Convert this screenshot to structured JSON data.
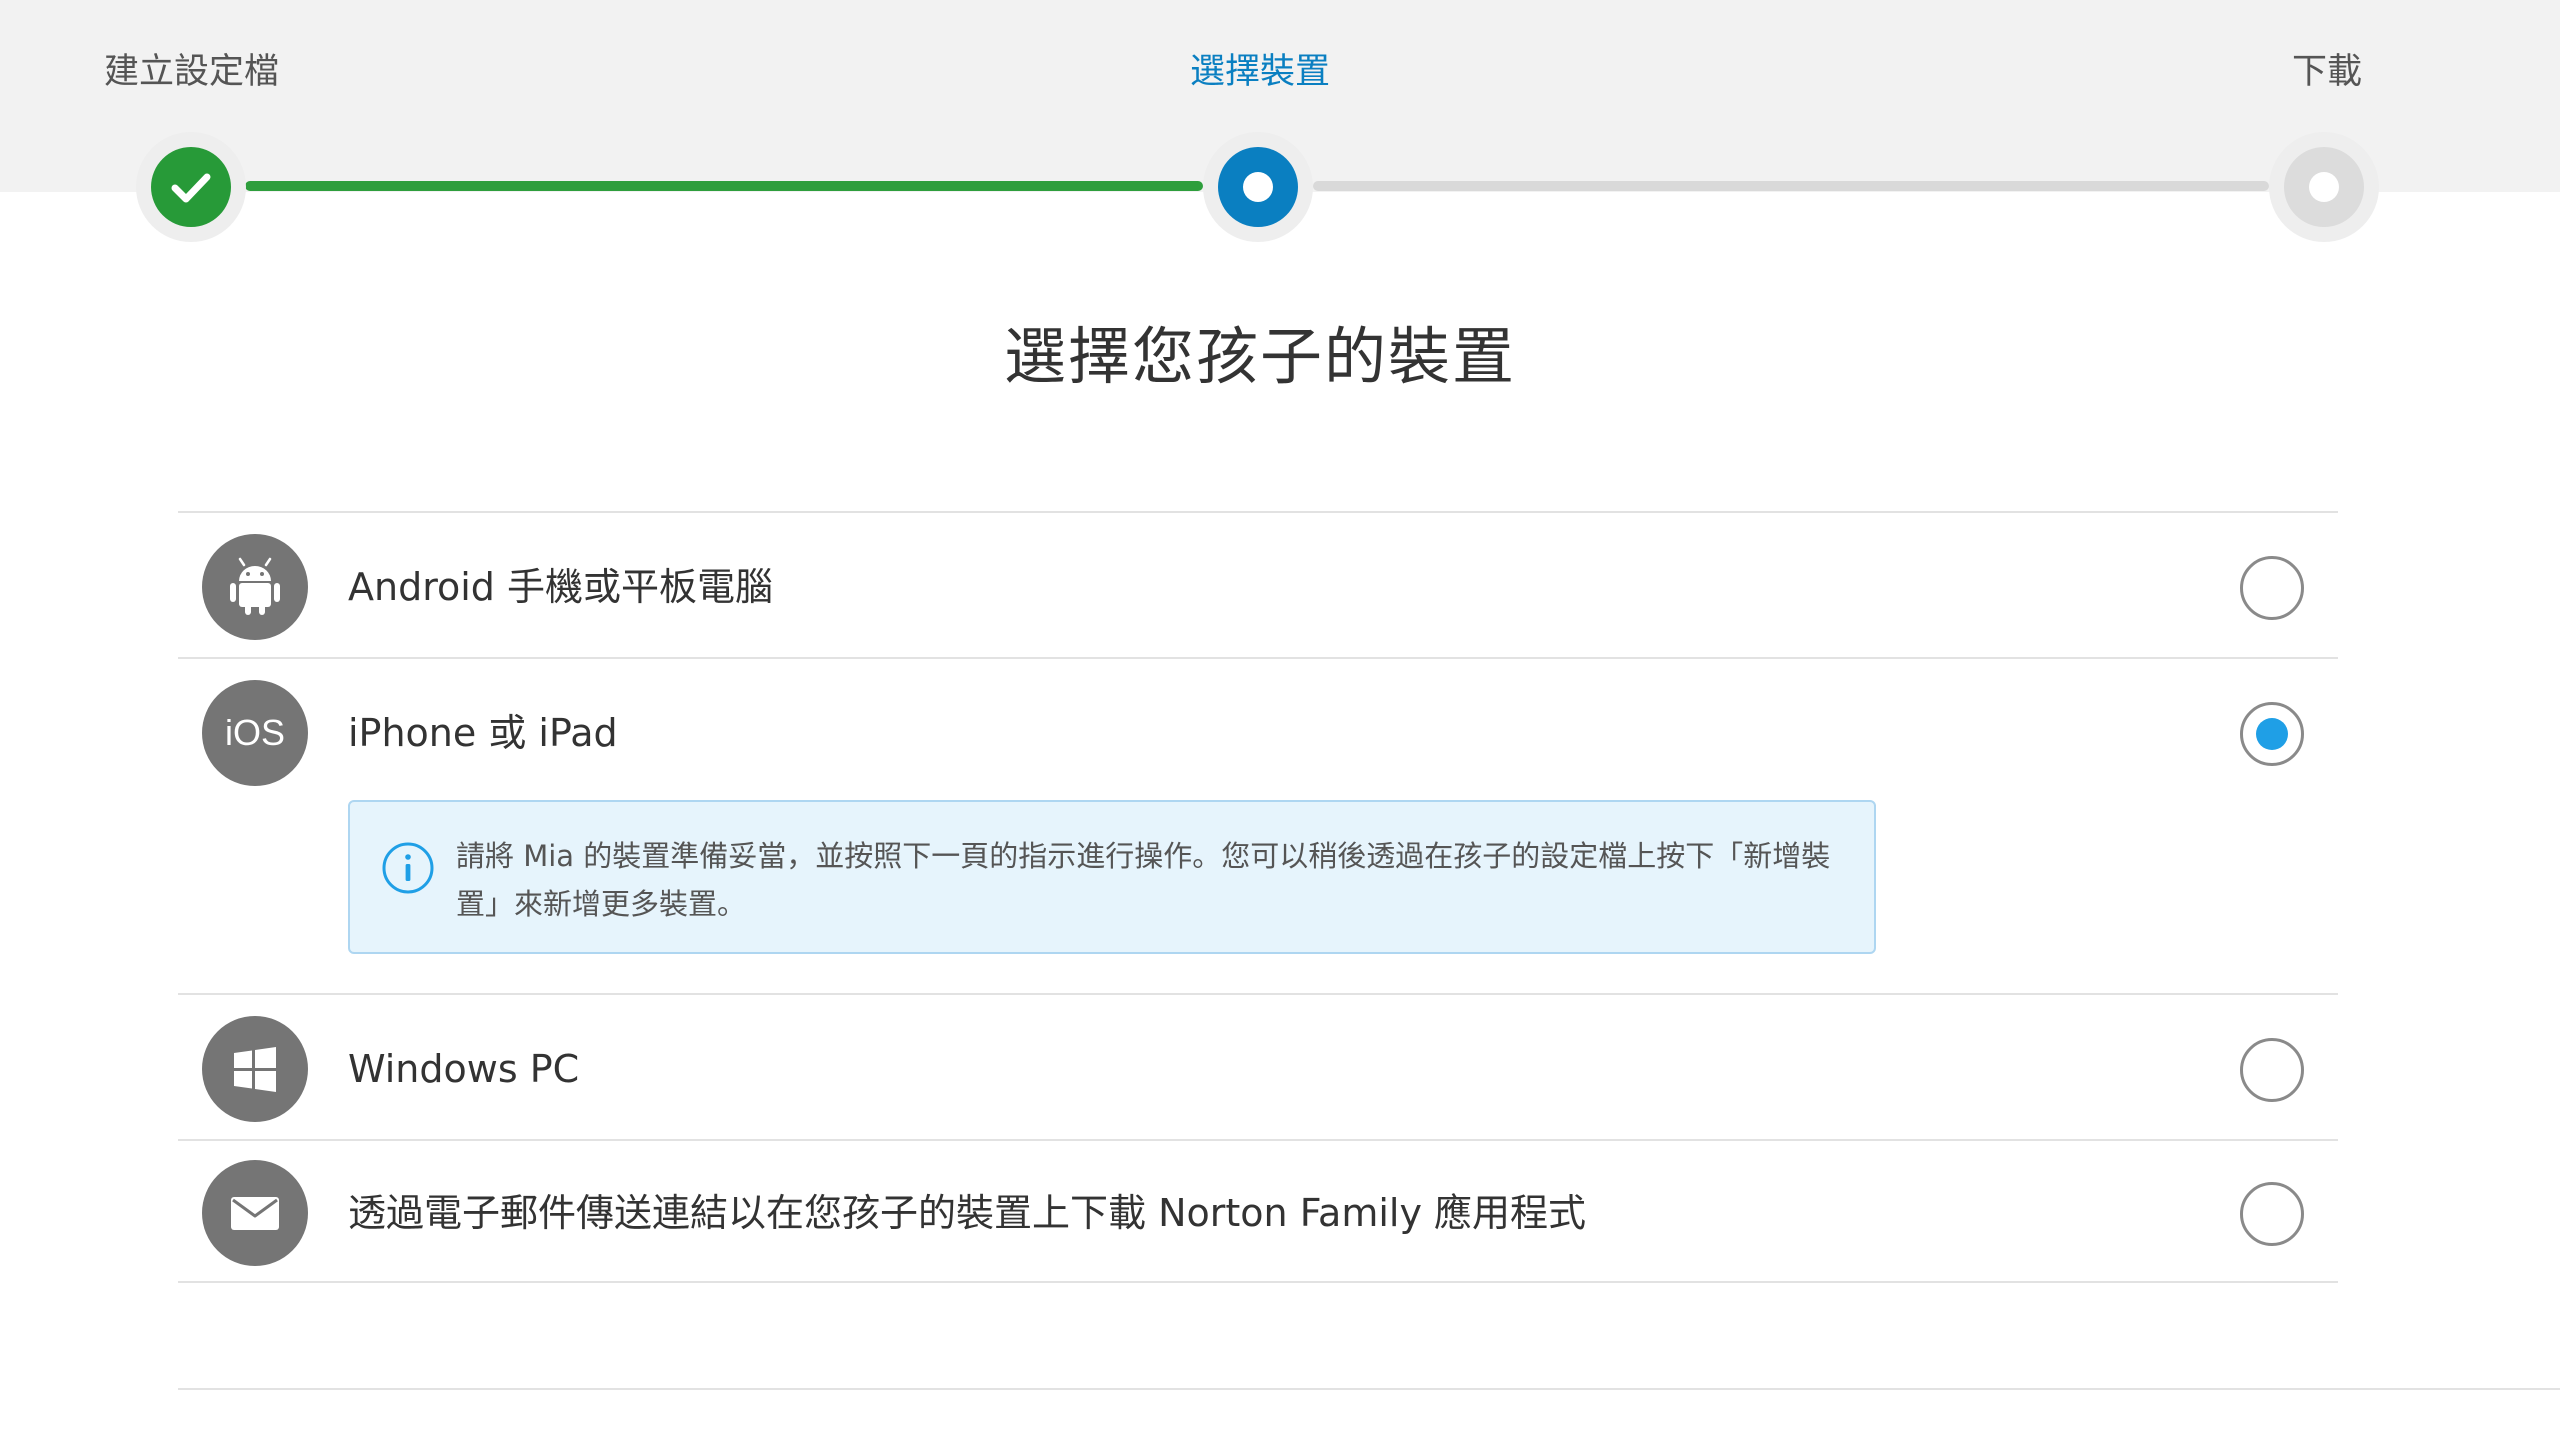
{
  "stepper": {
    "steps": [
      {
        "label": "建立設定檔",
        "state": "done"
      },
      {
        "label": "選擇裝置",
        "state": "active"
      },
      {
        "label": "下載",
        "state": "pending"
      }
    ],
    "colors": {
      "done": "#279a38",
      "active": "#0a7fc1",
      "pending": "#dcdcdc"
    }
  },
  "title": "選擇您孩子的裝置",
  "devices": [
    {
      "icon": "android-icon",
      "label": "Android 手機或平板電腦",
      "selected": false
    },
    {
      "icon": "ios-icon",
      "icon_text": "iOS",
      "label": "iPhone 或 iPad",
      "selected": true
    },
    {
      "icon": "windows-icon",
      "label": "Windows PC",
      "selected": false
    },
    {
      "icon": "email-icon",
      "label": "透過電子郵件傳送連結以在您孩子的裝置上下載 Norton Family 應用程式",
      "selected": false
    }
  ],
  "info": {
    "icon": "info-icon",
    "text": "請將 Mia 的裝置準備妥當，並按照下一頁的指示進行操作。您可以稍後透過在孩子的設定檔上按下「新增裝置」來新增更多裝置。"
  },
  "accent_color": "#1f9fe6"
}
